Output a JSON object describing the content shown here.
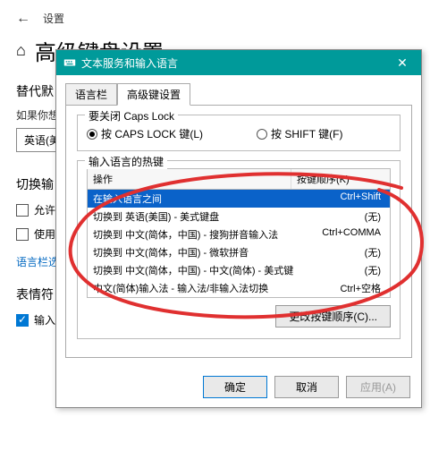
{
  "bg": {
    "topbar": {
      "back_glyph": "←",
      "label": "设置"
    },
    "header": {
      "icon_glyph": "⌂",
      "title": "高级键盘设置"
    },
    "section1": "替代默",
    "sub1": "如果你想何",
    "select_value": "英语(美",
    "section2": "切换输",
    "check_allow": "允许",
    "check_use": "使用",
    "link": "语言栏选项",
    "section3": "表情符",
    "check_input": "输入"
  },
  "dialog": {
    "title": "文本服务和输入语言",
    "tabs": [
      "语言栏",
      "高级键设置"
    ],
    "active_tab": 1,
    "capslock": {
      "legend": "要关闭 Caps Lock",
      "opt1": "按 CAPS LOCK 键(L)",
      "opt2": "按 SHIFT 键(F)",
      "selected": 0
    },
    "hotkeys": {
      "legend": "输入语言的热键",
      "col_action": "操作",
      "col_key": "按键顺序(K)",
      "rows": [
        {
          "action": "在输入语言之间",
          "key": "Ctrl+Shift",
          "selected": true
        },
        {
          "action": "切换到 英语(美国) - 美式键盘",
          "key": "(无)"
        },
        {
          "action": "切换到 中文(简体，中国) - 搜狗拼音输入法",
          "key": "Ctrl+COMMA"
        },
        {
          "action": "切换到 中文(简体，中国) - 微软拼音",
          "key": "(无)"
        },
        {
          "action": "切换到 中文(简体，中国) - 中文(简体) - 美式键盘",
          "key": "(无)"
        },
        {
          "action": "中文(简体)输入法 - 输入法/非输入法切换",
          "key": "Ctrl+空格"
        }
      ],
      "change_btn": "更改按键顺序(C)..."
    },
    "footer": {
      "ok": "确定",
      "cancel": "取消",
      "apply": "应用(A)"
    }
  }
}
